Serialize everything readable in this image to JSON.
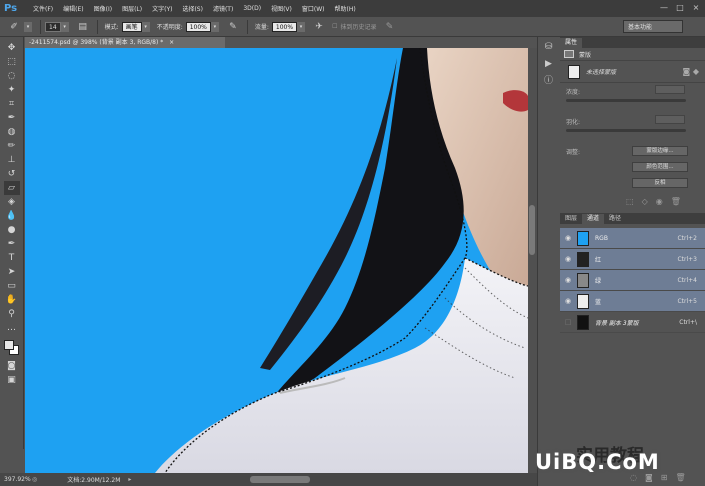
{
  "app": {
    "logo": "Ps",
    "menu": [
      "文件(F)",
      "编辑(E)",
      "图像(I)",
      "图层(L)",
      "文字(Y)",
      "选择(S)",
      "滤镜(T)",
      "3D(D)",
      "视图(V)",
      "窗口(W)",
      "帮助(H)"
    ],
    "window_controls": [
      "—",
      "□",
      "×"
    ]
  },
  "options_bar": {
    "brush_size": "14",
    "mode_label": "模式:",
    "mode_value": "画笔",
    "opacity_label": "不透明度:",
    "opacity_value": "100%",
    "flow_label": "流量:",
    "flow_value": "100%",
    "history_label": "抹到历史记录",
    "workspace": "基本功能"
  },
  "document": {
    "tab_title": "-2411574.psd @ 398% (背景 副本 3, RGB/8) *",
    "tab_close": "×",
    "zoom": "397.92%",
    "doc_info": "文档:2.90M/12.2M"
  },
  "properties": {
    "tabs": [
      "属性"
    ],
    "header_label": "蒙版",
    "mask_label": "未选择蒙版",
    "density_label": "浓度:",
    "feather_label": "羽化:",
    "adjust_label": "调整:",
    "buttons": [
      "蒙版边缘...",
      "颜色范围...",
      "反相"
    ]
  },
  "channels": {
    "tabs": [
      "图层",
      "通道",
      "路径"
    ],
    "rows": [
      {
        "name": "RGB",
        "shortcut": "Ctrl+2",
        "visible": true
      },
      {
        "name": "红",
        "shortcut": "Ctrl+3",
        "visible": true
      },
      {
        "name": "绿",
        "shortcut": "Ctrl+4",
        "visible": true
      },
      {
        "name": "蓝",
        "shortcut": "Ctrl+5",
        "visible": true
      },
      {
        "name": "背景 副本 3蒙版",
        "shortcut": "Ctrl+\\",
        "visible": false
      }
    ]
  },
  "watermark": {
    "text": "UiBQ.CoM",
    "text2": "实用教程"
  },
  "colors": {
    "canvas_bg": "#1ea1f2",
    "selected_row": "#6e7d95",
    "accent": "#4ea6ea"
  }
}
